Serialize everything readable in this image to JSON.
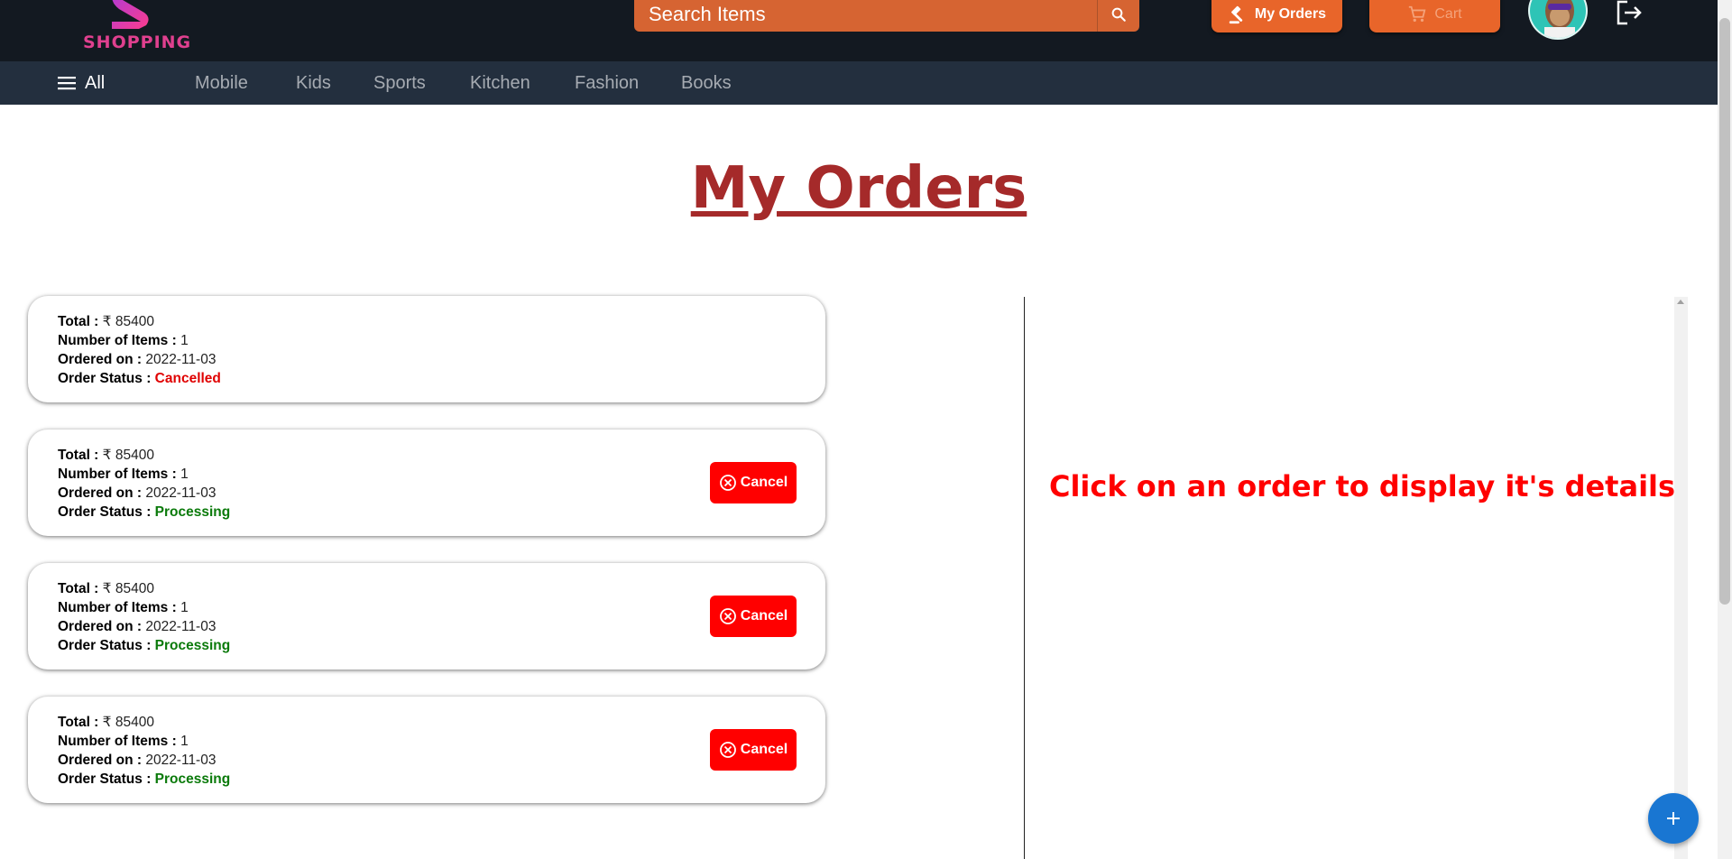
{
  "header": {
    "logo_text": "SHOPPING",
    "search": {
      "placeholder": "Search Items"
    },
    "my_orders_label": "My Orders",
    "cart_label": "Cart"
  },
  "nav": {
    "all_label": "All",
    "categories": [
      "Mobile",
      "Kids",
      "Sports",
      "Kitchen",
      "Fashion",
      "Books"
    ]
  },
  "page": {
    "title": "My Orders",
    "detail_placeholder": "Click on an order to display it's details"
  },
  "labels": {
    "total": "Total :",
    "items": "Number of Items :",
    "ordered_on": "Ordered on :",
    "status": "Order Status :",
    "cancel": "Cancel",
    "currency": "₹"
  },
  "orders": [
    {
      "total": "85400",
      "items": "1",
      "date": "2022-11-03",
      "status": "Cancelled"
    },
    {
      "total": "85400",
      "items": "1",
      "date": "2022-11-03",
      "status": "Processing"
    },
    {
      "total": "85400",
      "items": "1",
      "date": "2022-11-03",
      "status": "Processing"
    },
    {
      "total": "85400",
      "items": "1",
      "date": "2022-11-03",
      "status": "Processing"
    }
  ],
  "colors": {
    "topbar": "#131921",
    "navbar": "#232f3e",
    "accent": "#e8652a",
    "title": "#a52a2a",
    "cancelled": "#e00000",
    "processing": "#0a7a0a",
    "fab": "#1976d2"
  },
  "icons": [
    "search-icon",
    "gavel-icon",
    "cart-icon",
    "logout-icon",
    "menu-icon",
    "cancel-circle-icon",
    "plus-icon"
  ]
}
